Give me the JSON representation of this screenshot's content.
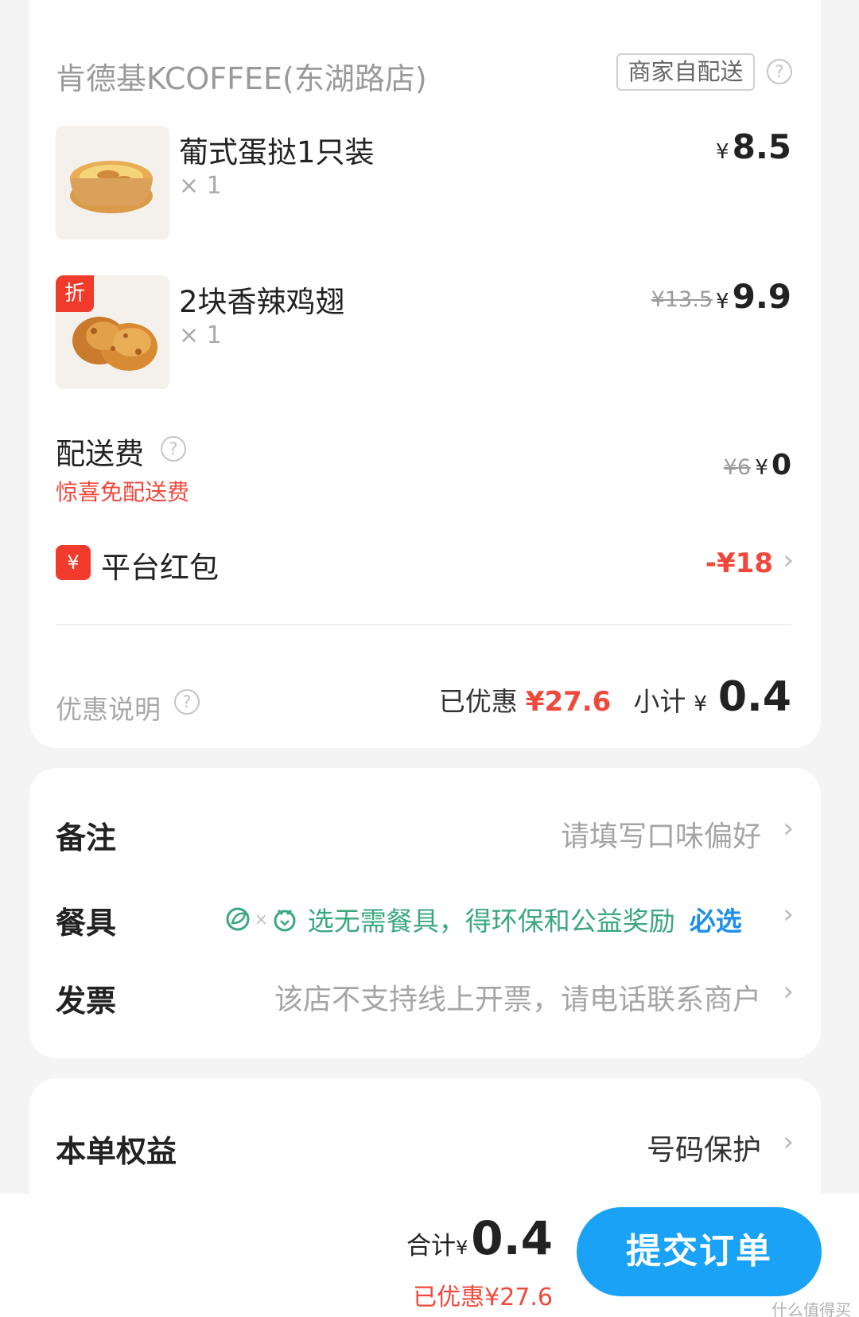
{
  "store": {
    "name": "肯德基KCOFFEE(东湖路店)",
    "delivery_badge": "商家自配送",
    "help_glyph": "?"
  },
  "items": [
    {
      "name": "葡式蛋挞1只装",
      "qty": "× 1",
      "currency": "¥",
      "price": "8.5",
      "original_price": ""
    },
    {
      "name": "2块香辣鸡翅",
      "qty": "× 1",
      "currency": "¥",
      "price": "9.9",
      "original_price": "¥13.5",
      "discount_tag": "折"
    }
  ],
  "delivery_fee": {
    "label": "配送费",
    "note": "惊喜免配送费",
    "original": "¥6",
    "currency": "¥",
    "value": "0"
  },
  "red_packet": {
    "icon_glyph": "¥",
    "label": "平台红包",
    "amount": "-¥18"
  },
  "summary": {
    "discount_note_label": "优惠说明",
    "saved_label": "已优惠",
    "saved_amount": "¥27.6",
    "subtotal_label": "小计",
    "subtotal_currency": "¥",
    "subtotal_value": "0.4"
  },
  "options": {
    "remark": {
      "label": "备注",
      "value": "请填写口味偏好"
    },
    "tableware": {
      "label": "餐具",
      "value": "选无需餐具，得环保和公益奖励",
      "required": "必选"
    },
    "invoice": {
      "label": "发票",
      "value": "该店不支持线上开票，请电话联系商户"
    }
  },
  "benefits": {
    "label": "本单权益",
    "value": "号码保护"
  },
  "footer": {
    "total_label": "合计",
    "total_currency": "¥",
    "total_value": "0.4",
    "saved_text": "已优惠¥27.6",
    "submit_label": "提交订单",
    "watermark": "什么值得买"
  },
  "colors": {
    "accent_red": "#f0493b",
    "submit_blue": "#1aa3f6",
    "eco_green": "#3aa87e",
    "link_blue": "#1f8fe8"
  },
  "icons": {
    "help": "question-circle-icon",
    "chevron": "chevron-right-icon",
    "red_packet": "red-packet-icon",
    "eco": "leaf-icon"
  }
}
